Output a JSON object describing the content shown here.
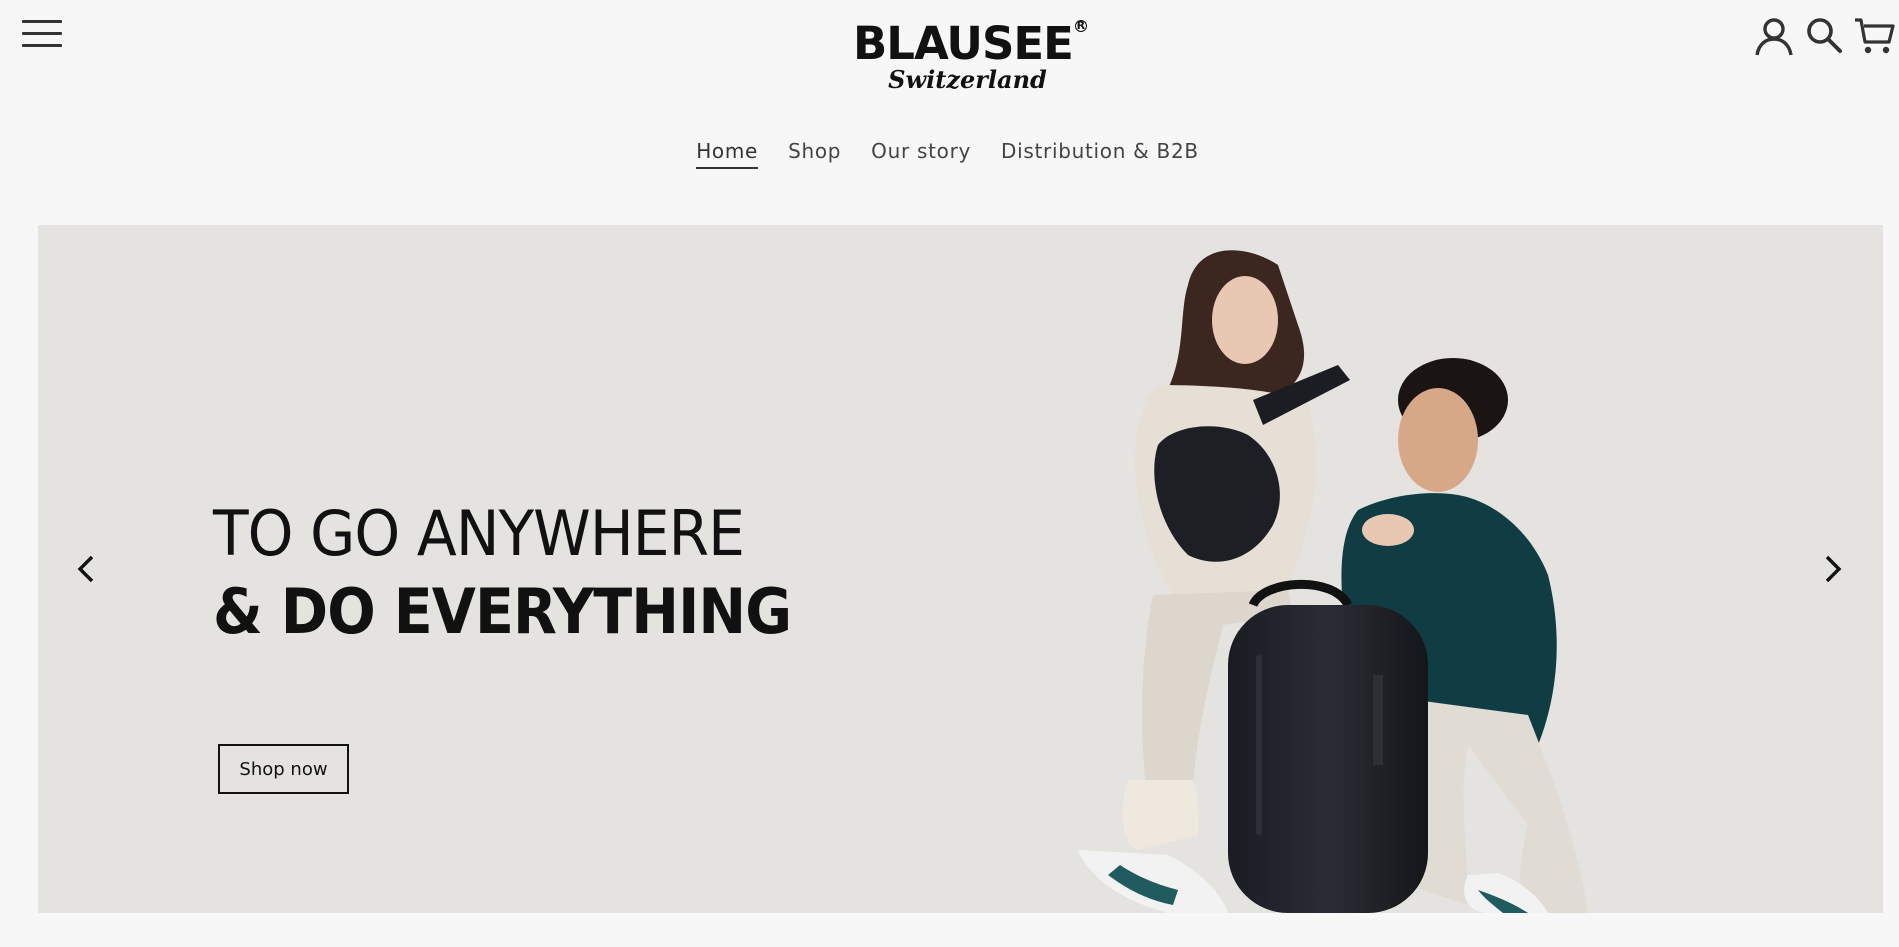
{
  "header": {
    "logo": {
      "brand": "BLAUSEE",
      "registered": "R",
      "subtitle": "Switzerland"
    },
    "icons": [
      "menu-icon",
      "account-icon",
      "search-icon",
      "cart-icon"
    ]
  },
  "nav": {
    "items": [
      {
        "label": "Home",
        "active": true
      },
      {
        "label": "Shop",
        "active": false
      },
      {
        "label": "Our story",
        "active": false
      },
      {
        "label": "Distribution & B2B",
        "active": false
      }
    ]
  },
  "hero": {
    "headline_line1": "TO GO ANYWHERE",
    "headline_line2": "& DO EVERYTHING",
    "cta_label": "Shop now",
    "background": "#e4e3df",
    "image_alt": "couple with black backpacks"
  },
  "colors": {
    "page_bg": "#f7f7f7",
    "text": "#222222",
    "accent": "#111111",
    "hoodie": "#0f3d43"
  }
}
